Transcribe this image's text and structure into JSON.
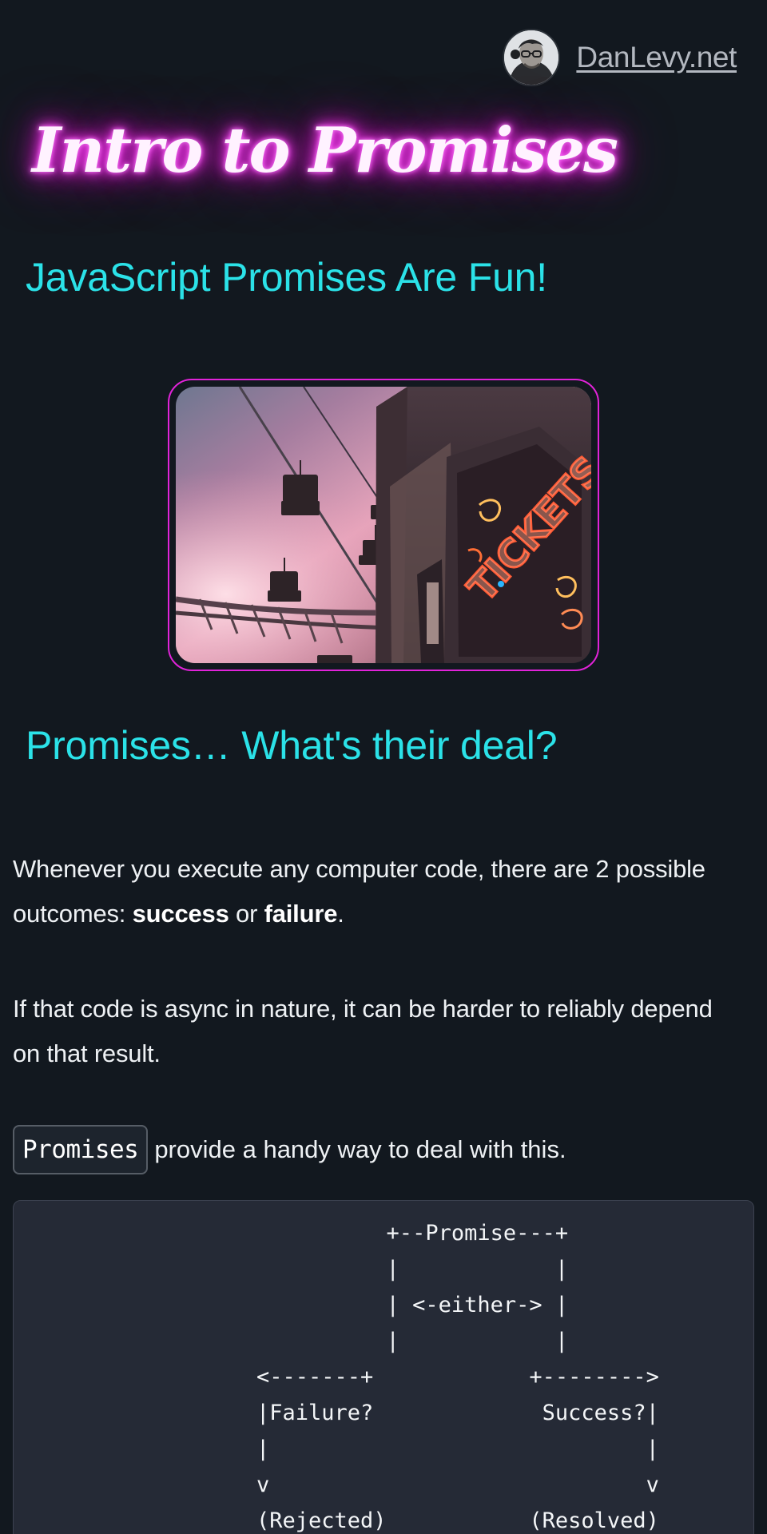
{
  "header": {
    "site_name": "DanLevy.net"
  },
  "hero": {
    "title": "Intro to Promises",
    "subtitle": "JavaScript Promises Are Fun!"
  },
  "image": {
    "alt": "Fairground with chairlift and neon tickets sign",
    "visible_sign_text": "TICKETS",
    "accent_color": "#e123d9"
  },
  "section": {
    "heading": "Promises… What's their deal?"
  },
  "paragraphs": {
    "first_before": "Whenever you execute any computer code, there are 2 possible outcomes: ",
    "success": "success",
    "middle": " or ",
    "failure": "failure",
    "period": ".",
    "second": "If that code is async in nature, it can be harder to reliably depend on that result."
  },
  "promises_line": {
    "code": "Promises",
    "text": " provide a handy way to deal with this."
  },
  "code_block": {
    "diagram": "          +--Promise---+\n          |            |\n          | <-either-> |\n          |            |\n<-------+            +-------->\n|Failure?             Success?|\n|                             |\nv                             v\n(Rejected)           (Resolved)"
  },
  "colors": {
    "background": "#12181f",
    "heading_accent": "#2be2e8",
    "neon_pink": "#ff3df7",
    "code_background": "#252a36"
  }
}
